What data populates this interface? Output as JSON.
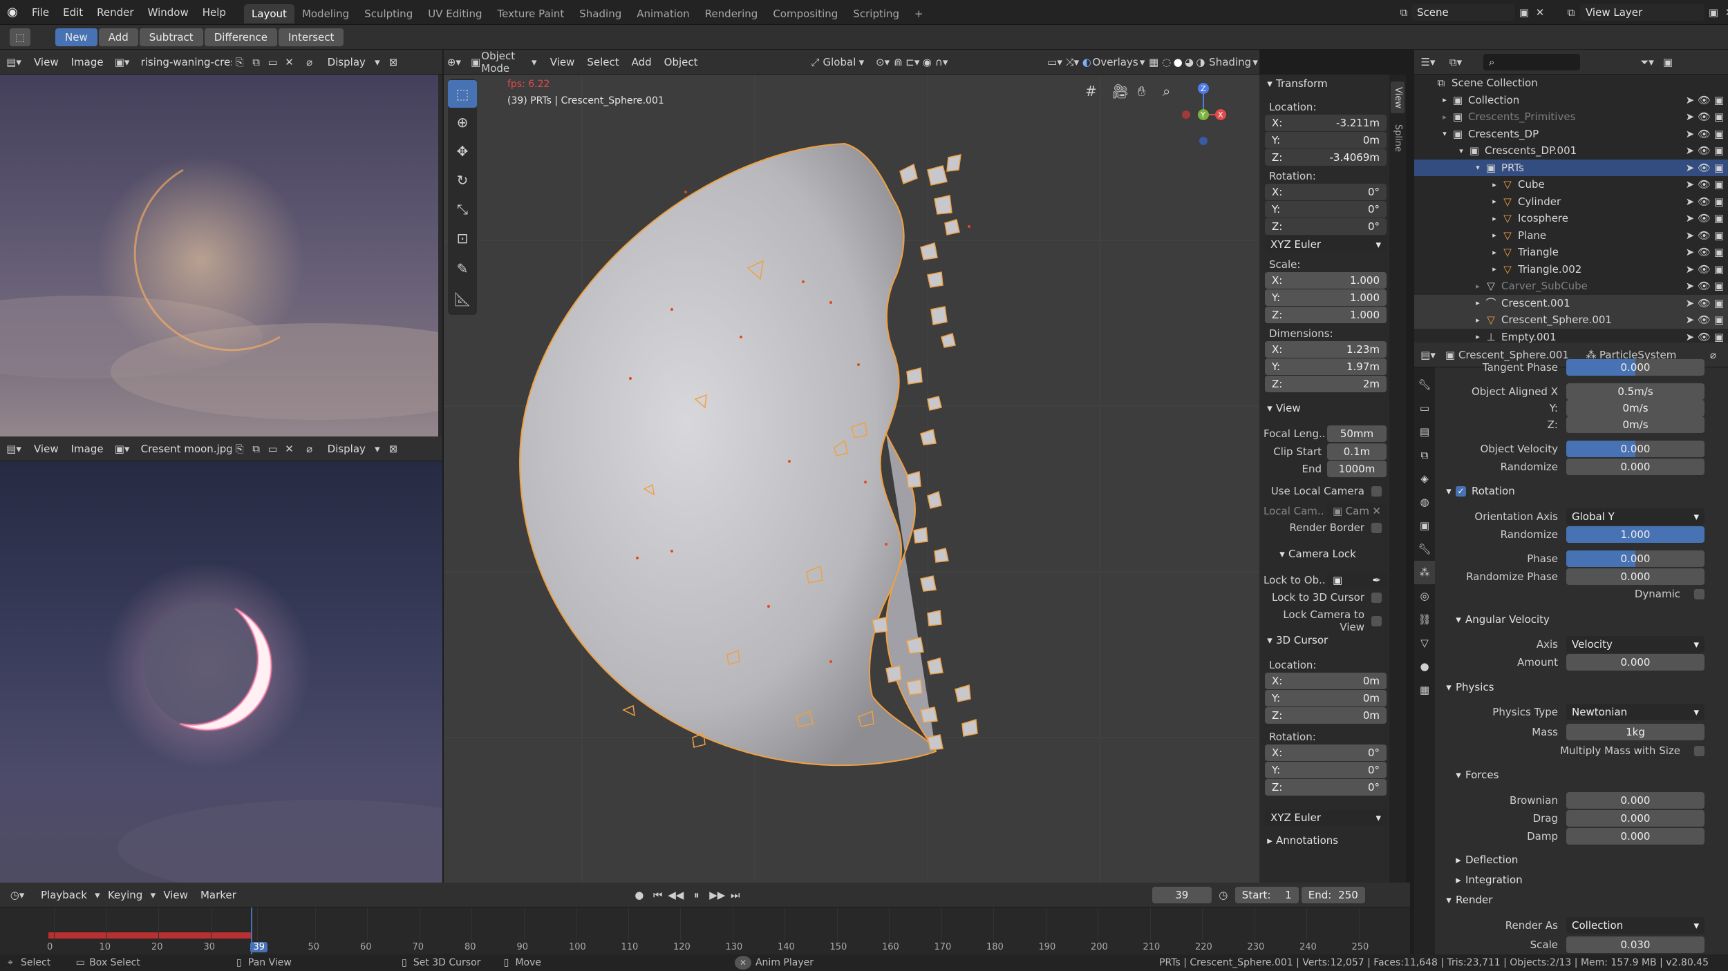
{
  "menubar": {
    "items": [
      "File",
      "Edit",
      "Render",
      "Window",
      "Help"
    ]
  },
  "workspaces": [
    "Layout",
    "Modeling",
    "Sculpting",
    "UV Editing",
    "Texture Paint",
    "Shading",
    "Animation",
    "Rendering",
    "Compositing",
    "Scripting",
    "+"
  ],
  "scene": {
    "name": "Scene",
    "view_layer": "View Layer"
  },
  "boolean_tools": {
    "new": "New",
    "add": "Add",
    "subtract": "Subtract",
    "difference": "Difference",
    "intersect": "Intersect"
  },
  "image_editor_top": {
    "view": "View",
    "image": "Image",
    "filename": "rising-waning-cres..",
    "display": "Display"
  },
  "image_editor_bottom": {
    "view": "View",
    "image": "Image",
    "filename": "Cresent moon.jpg",
    "display": "Display"
  },
  "viewport": {
    "mode": "Object Mode",
    "view": "View",
    "select": "Select",
    "add": "Add",
    "object": "Object",
    "orientation": "Global",
    "overlays": "Overlays",
    "shading": "Shading",
    "fps": "fps: 6.22",
    "info": "(39) PRTs | Crescent_Sphere.001",
    "side_tabs": [
      "View",
      "Spline"
    ]
  },
  "npanel": {
    "transform": "Transform",
    "location_label": "Location:",
    "loc": [
      "-3.211m",
      "0m",
      "-3.4069m"
    ],
    "rotation_label": "Rotation:",
    "rot": [
      "0°",
      "0°",
      "0°"
    ],
    "rot_mode": "XYZ Euler",
    "scale_label": "Scale:",
    "scale": [
      "1.000",
      "1.000",
      "1.000"
    ],
    "dims_label": "Dimensions:",
    "dims": [
      "1.23m",
      "1.97m",
      "2m"
    ],
    "axes": [
      "X:",
      "Y:",
      "Z:"
    ],
    "view": "View",
    "focal_label": "Focal Leng..",
    "focal": "50mm",
    "clip_start_label": "Clip Start",
    "clip_start": "0.1m",
    "clip_end_label": "End",
    "clip_end": "1000m",
    "use_local_camera": "Use Local Camera",
    "local_cam_label": "Local Cam..",
    "local_cam": "Cam",
    "render_border": "Render Border",
    "camera_lock": "Camera Lock",
    "lock_to_obj": "Lock to Ob..",
    "lock_3d_cursor": "Lock to 3D Cursor",
    "lock_camera_view": "Lock Camera to View",
    "cursor": "3D Cursor",
    "cursor_loc": [
      "0m",
      "0m",
      "0m"
    ],
    "cursor_rot": [
      "0°",
      "0°",
      "0°"
    ],
    "annotations": "Annotations"
  },
  "outliner": {
    "items": [
      {
        "label": "Scene Collection",
        "indent": 0
      },
      {
        "label": "Collection",
        "indent": 1
      },
      {
        "label": "Crescents_Primitives",
        "indent": 1
      },
      {
        "label": "Crescents_DP",
        "indent": 1
      },
      {
        "label": "Crescents_DP.001",
        "indent": 2
      },
      {
        "label": "PRTs",
        "indent": 3
      },
      {
        "label": "Cube",
        "indent": 4
      },
      {
        "label": "Cylinder",
        "indent": 4
      },
      {
        "label": "Icosphere",
        "indent": 4
      },
      {
        "label": "Plane",
        "indent": 4
      },
      {
        "label": "Triangle",
        "indent": 4
      },
      {
        "label": "Triangle.002",
        "indent": 4
      },
      {
        "label": "Carver_SubCube",
        "indent": 3
      },
      {
        "label": "Crescent.001",
        "indent": 3
      },
      {
        "label": "Crescent_Sphere.001",
        "indent": 3
      },
      {
        "label": "Empty.001",
        "indent": 3
      }
    ]
  },
  "properties": {
    "object": "Crescent_Sphere.001",
    "system": "ParticleSystem",
    "tangent_phase_label": "Tangent Phase",
    "tangent_phase": "0.000",
    "obj_aligned_label": "Object Aligned X",
    "obj_aligned": [
      "0.5m/s",
      "0m/s",
      "0m/s"
    ],
    "obj_velocity_label": "Object Velocity",
    "obj_velocity": "0.000",
    "randomize_label": "Randomize",
    "randomize": "0.000",
    "rotation": "Rotation",
    "orient_axis_label": "Orientation Axis",
    "orient_axis": "Global Y",
    "rot_randomize": "1.000",
    "phase_label": "Phase",
    "phase": "0.000",
    "rand_phase_label": "Randomize Phase",
    "rand_phase": "0.000",
    "dynamic_label": "Dynamic",
    "angular_velocity": "Angular Velocity",
    "axis_label": "Axis",
    "axis": "Velocity",
    "amount_label": "Amount",
    "amount": "0.000",
    "physics": "Physics",
    "physics_type_label": "Physics Type",
    "physics_type": "Newtonian",
    "mass_label": "Mass",
    "mass": "1kg",
    "mult_mass_label": "Multiply Mass with Size",
    "forces": "Forces",
    "brownian_label": "Brownian",
    "brownian": "0.000",
    "drag_label": "Drag",
    "drag": "0.000",
    "damp_label": "Damp",
    "damp": "0.000",
    "deflection": "Deflection",
    "integration": "Integration",
    "render": "Render",
    "render_as_label": "Render As",
    "render_as": "Collection",
    "scale_label": "Scale",
    "scale": "0.030"
  },
  "timeline": {
    "playback": "Playback",
    "keying": "Keying",
    "view": "View",
    "marker": "Marker",
    "current_frame": "39",
    "start_label": "Start:",
    "start": "1",
    "end_label": "End:",
    "end": "250",
    "ticks": [
      "0",
      "10",
      "20",
      "30",
      "39",
      "50",
      "60",
      "70",
      "80",
      "90",
      "100",
      "110",
      "120",
      "130",
      "140",
      "150",
      "160",
      "170",
      "180",
      "190",
      "200",
      "210",
      "220",
      "230",
      "240",
      "250"
    ]
  },
  "statusbar": {
    "select": "Select",
    "box_select": "Box Select",
    "pan_view": "Pan View",
    "set_cursor": "Set 3D Cursor",
    "move": "Move",
    "anim_player": "Anim Player",
    "stats": "PRTs | Crescent_Sphere.001 | Verts:12,057 | Faces:11,648 | Tris:23,711 | Objects:2/13 | Mem: 157.9 MB | v2.80.45"
  },
  "colors": {
    "accent": "#4772b3",
    "selection": "#f0a040",
    "bg": "#303030",
    "viewport": "#3d3d3d"
  }
}
